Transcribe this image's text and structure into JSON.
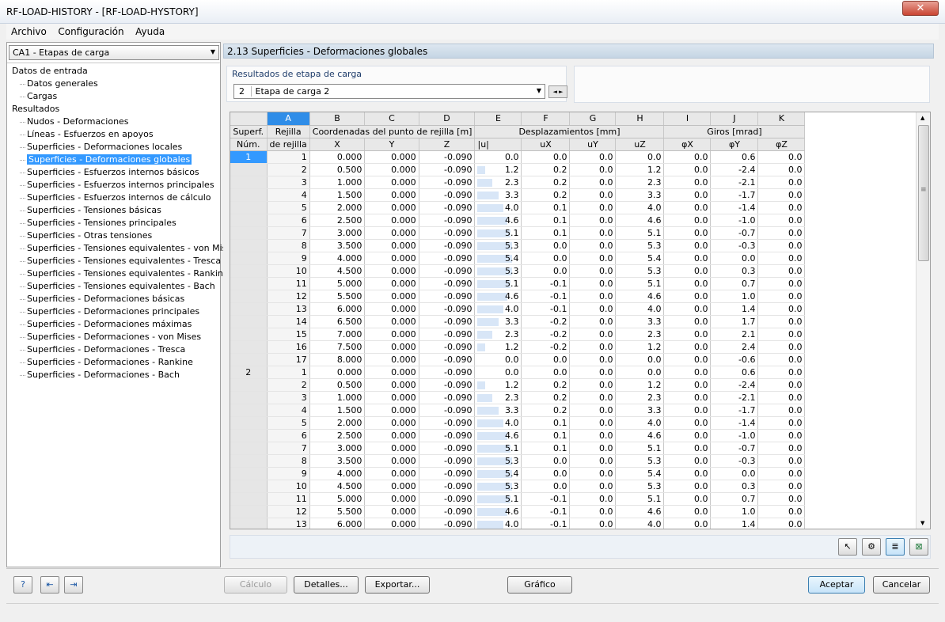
{
  "window": {
    "title": "RF-LOAD-HISTORY - [RF-LOAD-HYSTORY]",
    "close_label": "✕"
  },
  "menu": [
    "Archivo",
    "Configuración",
    "Ayuda"
  ],
  "case_selector": {
    "value": "CA1 - Etapas de carga"
  },
  "tree": {
    "input_header": "Datos de entrada",
    "input_items": [
      "Datos generales",
      "Cargas"
    ],
    "results_header": "Resultados",
    "results_items": [
      "Nudos - Deformaciones",
      "Líneas - Esfuerzos en apoyos",
      "Superficies - Deformaciones locales",
      "Superficies - Deformaciones globales",
      "Superficies - Esfuerzos internos básicos",
      "Superficies - Esfuerzos internos principales",
      "Superficies - Esfuerzos internos de cálculo",
      "Superficies - Tensiones básicas",
      "Superficies - Tensiones principales",
      "Superficies - Otras tensiones",
      "Superficies - Tensiones equivalentes - von Mises",
      "Superficies - Tensiones equivalentes - Tresca",
      "Superficies - Tensiones equivalentes - Rankine",
      "Superficies - Tensiones equivalentes - Bach",
      "Superficies - Deformaciones básicas",
      "Superficies - Deformaciones principales",
      "Superficies - Deformaciones máximas",
      "Superficies - Deformaciones - von Mises",
      "Superficies - Deformaciones - Tresca",
      "Superficies - Deformaciones - Rankine",
      "Superficies - Deformaciones - Bach"
    ],
    "selected_index": 3
  },
  "panel": {
    "title": "2.13 Superficies - Deformaciones globales",
    "results_label": "Resultados de etapa de carga",
    "stage_number": "2",
    "stage_name": "Etapa de carga 2"
  },
  "table": {
    "col_letters": [
      "A",
      "B",
      "C",
      "D",
      "E",
      "F",
      "G",
      "H",
      "I",
      "J",
      "K"
    ],
    "h_superf": "Superf.",
    "h_num": "Núm.",
    "h_rejilla1": "Rejilla",
    "h_rejilla2": "de rejilla",
    "h_coords": "Coordenadas del punto de rejilla [m]",
    "h_desp": "Desplazamientos [mm]",
    "h_giros": "Giros [mrad]",
    "sub": [
      "X",
      "Y",
      "Z",
      "|u|",
      "uX",
      "uY",
      "uZ",
      "φX",
      "φY",
      "φZ"
    ],
    "rows": [
      [
        "1",
        "1",
        "0.000",
        "0.000",
        "-0.090",
        "0.0",
        "0.0",
        "0.0",
        "0.0",
        "0.0",
        "0.6",
        "0.0"
      ],
      [
        "",
        "2",
        "0.500",
        "0.000",
        "-0.090",
        "1.2",
        "0.2",
        "0.0",
        "1.2",
        "0.0",
        "-2.4",
        "0.0"
      ],
      [
        "",
        "3",
        "1.000",
        "0.000",
        "-0.090",
        "2.3",
        "0.2",
        "0.0",
        "2.3",
        "0.0",
        "-2.1",
        "0.0"
      ],
      [
        "",
        "4",
        "1.500",
        "0.000",
        "-0.090",
        "3.3",
        "0.2",
        "0.0",
        "3.3",
        "0.0",
        "-1.7",
        "0.0"
      ],
      [
        "",
        "5",
        "2.000",
        "0.000",
        "-0.090",
        "4.0",
        "0.1",
        "0.0",
        "4.0",
        "0.0",
        "-1.4",
        "0.0"
      ],
      [
        "",
        "6",
        "2.500",
        "0.000",
        "-0.090",
        "4.6",
        "0.1",
        "0.0",
        "4.6",
        "0.0",
        "-1.0",
        "0.0"
      ],
      [
        "",
        "7",
        "3.000",
        "0.000",
        "-0.090",
        "5.1",
        "0.1",
        "0.0",
        "5.1",
        "0.0",
        "-0.7",
        "0.0"
      ],
      [
        "",
        "8",
        "3.500",
        "0.000",
        "-0.090",
        "5.3",
        "0.0",
        "0.0",
        "5.3",
        "0.0",
        "-0.3",
        "0.0"
      ],
      [
        "",
        "9",
        "4.000",
        "0.000",
        "-0.090",
        "5.4",
        "0.0",
        "0.0",
        "5.4",
        "0.0",
        "0.0",
        "0.0"
      ],
      [
        "",
        "10",
        "4.500",
        "0.000",
        "-0.090",
        "5.3",
        "0.0",
        "0.0",
        "5.3",
        "0.0",
        "0.3",
        "0.0"
      ],
      [
        "",
        "11",
        "5.000",
        "0.000",
        "-0.090",
        "5.1",
        "-0.1",
        "0.0",
        "5.1",
        "0.0",
        "0.7",
        "0.0"
      ],
      [
        "",
        "12",
        "5.500",
        "0.000",
        "-0.090",
        "4.6",
        "-0.1",
        "0.0",
        "4.6",
        "0.0",
        "1.0",
        "0.0"
      ],
      [
        "",
        "13",
        "6.000",
        "0.000",
        "-0.090",
        "4.0",
        "-0.1",
        "0.0",
        "4.0",
        "0.0",
        "1.4",
        "0.0"
      ],
      [
        "",
        "14",
        "6.500",
        "0.000",
        "-0.090",
        "3.3",
        "-0.2",
        "0.0",
        "3.3",
        "0.0",
        "1.7",
        "0.0"
      ],
      [
        "",
        "15",
        "7.000",
        "0.000",
        "-0.090",
        "2.3",
        "-0.2",
        "0.0",
        "2.3",
        "0.0",
        "2.1",
        "0.0"
      ],
      [
        "",
        "16",
        "7.500",
        "0.000",
        "-0.090",
        "1.2",
        "-0.2",
        "0.0",
        "1.2",
        "0.0",
        "2.4",
        "0.0"
      ],
      [
        "",
        "17",
        "8.000",
        "0.000",
        "-0.090",
        "0.0",
        "0.0",
        "0.0",
        "0.0",
        "0.0",
        "-0.6",
        "0.0"
      ],
      [
        "2",
        "1",
        "0.000",
        "0.000",
        "-0.090",
        "0.0",
        "0.0",
        "0.0",
        "0.0",
        "0.0",
        "0.6",
        "0.0"
      ],
      [
        "",
        "2",
        "0.500",
        "0.000",
        "-0.090",
        "1.2",
        "0.2",
        "0.0",
        "1.2",
        "0.0",
        "-2.4",
        "0.0"
      ],
      [
        "",
        "3",
        "1.000",
        "0.000",
        "-0.090",
        "2.3",
        "0.2",
        "0.0",
        "2.3",
        "0.0",
        "-2.1",
        "0.0"
      ],
      [
        "",
        "4",
        "1.500",
        "0.000",
        "-0.090",
        "3.3",
        "0.2",
        "0.0",
        "3.3",
        "0.0",
        "-1.7",
        "0.0"
      ],
      [
        "",
        "5",
        "2.000",
        "0.000",
        "-0.090",
        "4.0",
        "0.1",
        "0.0",
        "4.0",
        "0.0",
        "-1.4",
        "0.0"
      ],
      [
        "",
        "6",
        "2.500",
        "0.000",
        "-0.090",
        "4.6",
        "0.1",
        "0.0",
        "4.6",
        "0.0",
        "-1.0",
        "0.0"
      ],
      [
        "",
        "7",
        "3.000",
        "0.000",
        "-0.090",
        "5.1",
        "0.1",
        "0.0",
        "5.1",
        "0.0",
        "-0.7",
        "0.0"
      ],
      [
        "",
        "8",
        "3.500",
        "0.000",
        "-0.090",
        "5.3",
        "0.0",
        "0.0",
        "5.3",
        "0.0",
        "-0.3",
        "0.0"
      ],
      [
        "",
        "9",
        "4.000",
        "0.000",
        "-0.090",
        "5.4",
        "0.0",
        "0.0",
        "5.4",
        "0.0",
        "0.0",
        "0.0"
      ],
      [
        "",
        "10",
        "4.500",
        "0.000",
        "-0.090",
        "5.3",
        "0.0",
        "0.0",
        "5.3",
        "0.0",
        "0.3",
        "0.0"
      ],
      [
        "",
        "11",
        "5.000",
        "0.000",
        "-0.090",
        "5.1",
        "-0.1",
        "0.0",
        "5.1",
        "0.0",
        "0.7",
        "0.0"
      ],
      [
        "",
        "12",
        "5.500",
        "0.000",
        "-0.090",
        "4.6",
        "-0.1",
        "0.0",
        "4.6",
        "0.0",
        "1.0",
        "0.0"
      ],
      [
        "",
        "13",
        "6.000",
        "0.000",
        "-0.090",
        "4.0",
        "-0.1",
        "0.0",
        "4.0",
        "0.0",
        "1.4",
        "0.0"
      ]
    ]
  },
  "buttons": {
    "calculo": "Cálculo",
    "detalles": "Detalles...",
    "exportar": "Exportar...",
    "grafico": "Gráfico",
    "aceptar": "Aceptar",
    "cancelar": "Cancelar"
  },
  "icons": {
    "help": "help-icon",
    "import": "import-icon",
    "export": "export-icon",
    "pointer": "pointer-icon",
    "settings": "settings-icon",
    "bars": "bar-chart-icon",
    "excel": "excel-icon"
  }
}
